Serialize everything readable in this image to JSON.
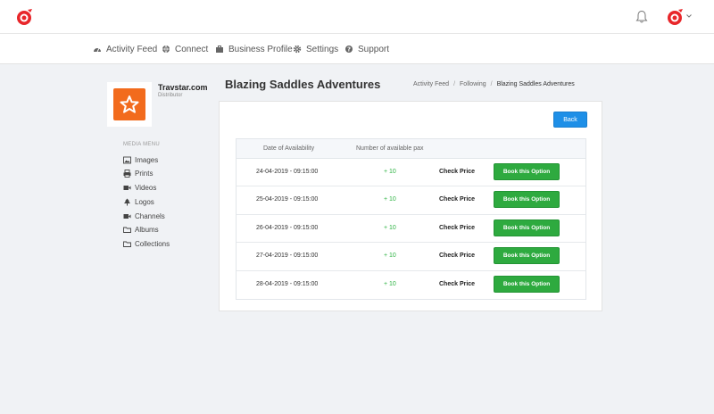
{
  "nav": {
    "items": [
      {
        "label": "Activity Feed",
        "icon": "dashboard-icon"
      },
      {
        "label": "Connect",
        "icon": "globe-icon"
      },
      {
        "label": "Business Profile",
        "icon": "briefcase-icon"
      },
      {
        "label": "Settings",
        "icon": "gear-icon"
      },
      {
        "label": "Support",
        "icon": "question-icon"
      }
    ]
  },
  "profile": {
    "name": "Travstar.com",
    "role": "Distributor"
  },
  "media_menu": {
    "title": "MEDIA MENU",
    "items": [
      {
        "label": "Images",
        "icon": "image-icon"
      },
      {
        "label": "Prints",
        "icon": "printer-icon"
      },
      {
        "label": "Videos",
        "icon": "video-icon"
      },
      {
        "label": "Logos",
        "icon": "tree-icon"
      },
      {
        "label": "Channels",
        "icon": "video-icon"
      },
      {
        "label": "Albums",
        "icon": "folder-icon"
      },
      {
        "label": "Collections",
        "icon": "folder-icon"
      }
    ]
  },
  "page": {
    "title": "Blazing Saddles Adventures",
    "breadcrumb": [
      "Activity Feed",
      "Following",
      "Blazing Saddles Adventures"
    ],
    "back_label": "Back"
  },
  "table": {
    "headers": [
      "Date of Availability",
      "Number of available pax"
    ],
    "rows": [
      {
        "date": "24-04-2019 - 09:15:00",
        "pax": "+ 10",
        "price": "Check Price",
        "action": "Book this Option"
      },
      {
        "date": "25-04-2019 - 09:15:00",
        "pax": "+ 10",
        "price": "Check Price",
        "action": "Book this Option"
      },
      {
        "date": "26-04-2019 - 09:15:00",
        "pax": "+ 10",
        "price": "Check Price",
        "action": "Book this Option"
      },
      {
        "date": "27-04-2019 - 09:15:00",
        "pax": "+ 10",
        "price": "Check Price",
        "action": "Book this Option"
      },
      {
        "date": "28-04-2019 - 09:15:00",
        "pax": "+ 10",
        "price": "Check Price",
        "action": "Book this Option"
      }
    ]
  },
  "colors": {
    "brand_red": "#e8262a",
    "accent_orange": "#f26b1d",
    "primary_blue": "#1e8fe7",
    "success_green": "#2eaa3f"
  }
}
